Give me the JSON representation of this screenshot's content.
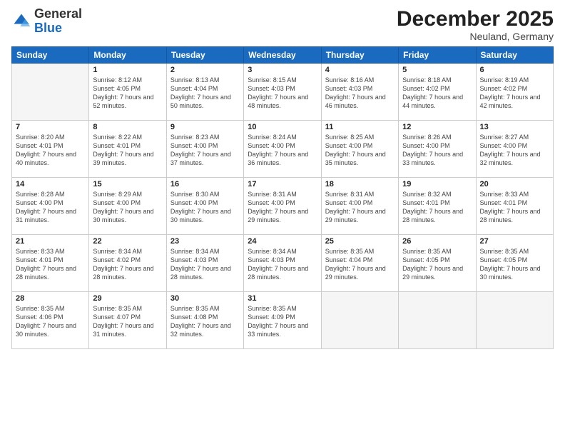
{
  "logo": {
    "general": "General",
    "blue": "Blue"
  },
  "header": {
    "month": "December 2025",
    "location": "Neuland, Germany"
  },
  "weekdays": [
    "Sunday",
    "Monday",
    "Tuesday",
    "Wednesday",
    "Thursday",
    "Friday",
    "Saturday"
  ],
  "weeks": [
    [
      {
        "day": "",
        "sunrise": "",
        "sunset": "",
        "daylight": ""
      },
      {
        "day": "1",
        "sunrise": "Sunrise: 8:12 AM",
        "sunset": "Sunset: 4:05 PM",
        "daylight": "Daylight: 7 hours and 52 minutes."
      },
      {
        "day": "2",
        "sunrise": "Sunrise: 8:13 AM",
        "sunset": "Sunset: 4:04 PM",
        "daylight": "Daylight: 7 hours and 50 minutes."
      },
      {
        "day": "3",
        "sunrise": "Sunrise: 8:15 AM",
        "sunset": "Sunset: 4:03 PM",
        "daylight": "Daylight: 7 hours and 48 minutes."
      },
      {
        "day": "4",
        "sunrise": "Sunrise: 8:16 AM",
        "sunset": "Sunset: 4:03 PM",
        "daylight": "Daylight: 7 hours and 46 minutes."
      },
      {
        "day": "5",
        "sunrise": "Sunrise: 8:18 AM",
        "sunset": "Sunset: 4:02 PM",
        "daylight": "Daylight: 7 hours and 44 minutes."
      },
      {
        "day": "6",
        "sunrise": "Sunrise: 8:19 AM",
        "sunset": "Sunset: 4:02 PM",
        "daylight": "Daylight: 7 hours and 42 minutes."
      }
    ],
    [
      {
        "day": "7",
        "sunrise": "Sunrise: 8:20 AM",
        "sunset": "Sunset: 4:01 PM",
        "daylight": "Daylight: 7 hours and 40 minutes."
      },
      {
        "day": "8",
        "sunrise": "Sunrise: 8:22 AM",
        "sunset": "Sunset: 4:01 PM",
        "daylight": "Daylight: 7 hours and 39 minutes."
      },
      {
        "day": "9",
        "sunrise": "Sunrise: 8:23 AM",
        "sunset": "Sunset: 4:00 PM",
        "daylight": "Daylight: 7 hours and 37 minutes."
      },
      {
        "day": "10",
        "sunrise": "Sunrise: 8:24 AM",
        "sunset": "Sunset: 4:00 PM",
        "daylight": "Daylight: 7 hours and 36 minutes."
      },
      {
        "day": "11",
        "sunrise": "Sunrise: 8:25 AM",
        "sunset": "Sunset: 4:00 PM",
        "daylight": "Daylight: 7 hours and 35 minutes."
      },
      {
        "day": "12",
        "sunrise": "Sunrise: 8:26 AM",
        "sunset": "Sunset: 4:00 PM",
        "daylight": "Daylight: 7 hours and 33 minutes."
      },
      {
        "day": "13",
        "sunrise": "Sunrise: 8:27 AM",
        "sunset": "Sunset: 4:00 PM",
        "daylight": "Daylight: 7 hours and 32 minutes."
      }
    ],
    [
      {
        "day": "14",
        "sunrise": "Sunrise: 8:28 AM",
        "sunset": "Sunset: 4:00 PM",
        "daylight": "Daylight: 7 hours and 31 minutes."
      },
      {
        "day": "15",
        "sunrise": "Sunrise: 8:29 AM",
        "sunset": "Sunset: 4:00 PM",
        "daylight": "Daylight: 7 hours and 30 minutes."
      },
      {
        "day": "16",
        "sunrise": "Sunrise: 8:30 AM",
        "sunset": "Sunset: 4:00 PM",
        "daylight": "Daylight: 7 hours and 30 minutes."
      },
      {
        "day": "17",
        "sunrise": "Sunrise: 8:31 AM",
        "sunset": "Sunset: 4:00 PM",
        "daylight": "Daylight: 7 hours and 29 minutes."
      },
      {
        "day": "18",
        "sunrise": "Sunrise: 8:31 AM",
        "sunset": "Sunset: 4:00 PM",
        "daylight": "Daylight: 7 hours and 29 minutes."
      },
      {
        "day": "19",
        "sunrise": "Sunrise: 8:32 AM",
        "sunset": "Sunset: 4:01 PM",
        "daylight": "Daylight: 7 hours and 28 minutes."
      },
      {
        "day": "20",
        "sunrise": "Sunrise: 8:33 AM",
        "sunset": "Sunset: 4:01 PM",
        "daylight": "Daylight: 7 hours and 28 minutes."
      }
    ],
    [
      {
        "day": "21",
        "sunrise": "Sunrise: 8:33 AM",
        "sunset": "Sunset: 4:01 PM",
        "daylight": "Daylight: 7 hours and 28 minutes."
      },
      {
        "day": "22",
        "sunrise": "Sunrise: 8:34 AM",
        "sunset": "Sunset: 4:02 PM",
        "daylight": "Daylight: 7 hours and 28 minutes."
      },
      {
        "day": "23",
        "sunrise": "Sunrise: 8:34 AM",
        "sunset": "Sunset: 4:03 PM",
        "daylight": "Daylight: 7 hours and 28 minutes."
      },
      {
        "day": "24",
        "sunrise": "Sunrise: 8:34 AM",
        "sunset": "Sunset: 4:03 PM",
        "daylight": "Daylight: 7 hours and 28 minutes."
      },
      {
        "day": "25",
        "sunrise": "Sunrise: 8:35 AM",
        "sunset": "Sunset: 4:04 PM",
        "daylight": "Daylight: 7 hours and 29 minutes."
      },
      {
        "day": "26",
        "sunrise": "Sunrise: 8:35 AM",
        "sunset": "Sunset: 4:05 PM",
        "daylight": "Daylight: 7 hours and 29 minutes."
      },
      {
        "day": "27",
        "sunrise": "Sunrise: 8:35 AM",
        "sunset": "Sunset: 4:05 PM",
        "daylight": "Daylight: 7 hours and 30 minutes."
      }
    ],
    [
      {
        "day": "28",
        "sunrise": "Sunrise: 8:35 AM",
        "sunset": "Sunset: 4:06 PM",
        "daylight": "Daylight: 7 hours and 30 minutes."
      },
      {
        "day": "29",
        "sunrise": "Sunrise: 8:35 AM",
        "sunset": "Sunset: 4:07 PM",
        "daylight": "Daylight: 7 hours and 31 minutes."
      },
      {
        "day": "30",
        "sunrise": "Sunrise: 8:35 AM",
        "sunset": "Sunset: 4:08 PM",
        "daylight": "Daylight: 7 hours and 32 minutes."
      },
      {
        "day": "31",
        "sunrise": "Sunrise: 8:35 AM",
        "sunset": "Sunset: 4:09 PM",
        "daylight": "Daylight: 7 hours and 33 minutes."
      },
      {
        "day": "",
        "sunrise": "",
        "sunset": "",
        "daylight": ""
      },
      {
        "day": "",
        "sunrise": "",
        "sunset": "",
        "daylight": ""
      },
      {
        "day": "",
        "sunrise": "",
        "sunset": "",
        "daylight": ""
      }
    ]
  ]
}
